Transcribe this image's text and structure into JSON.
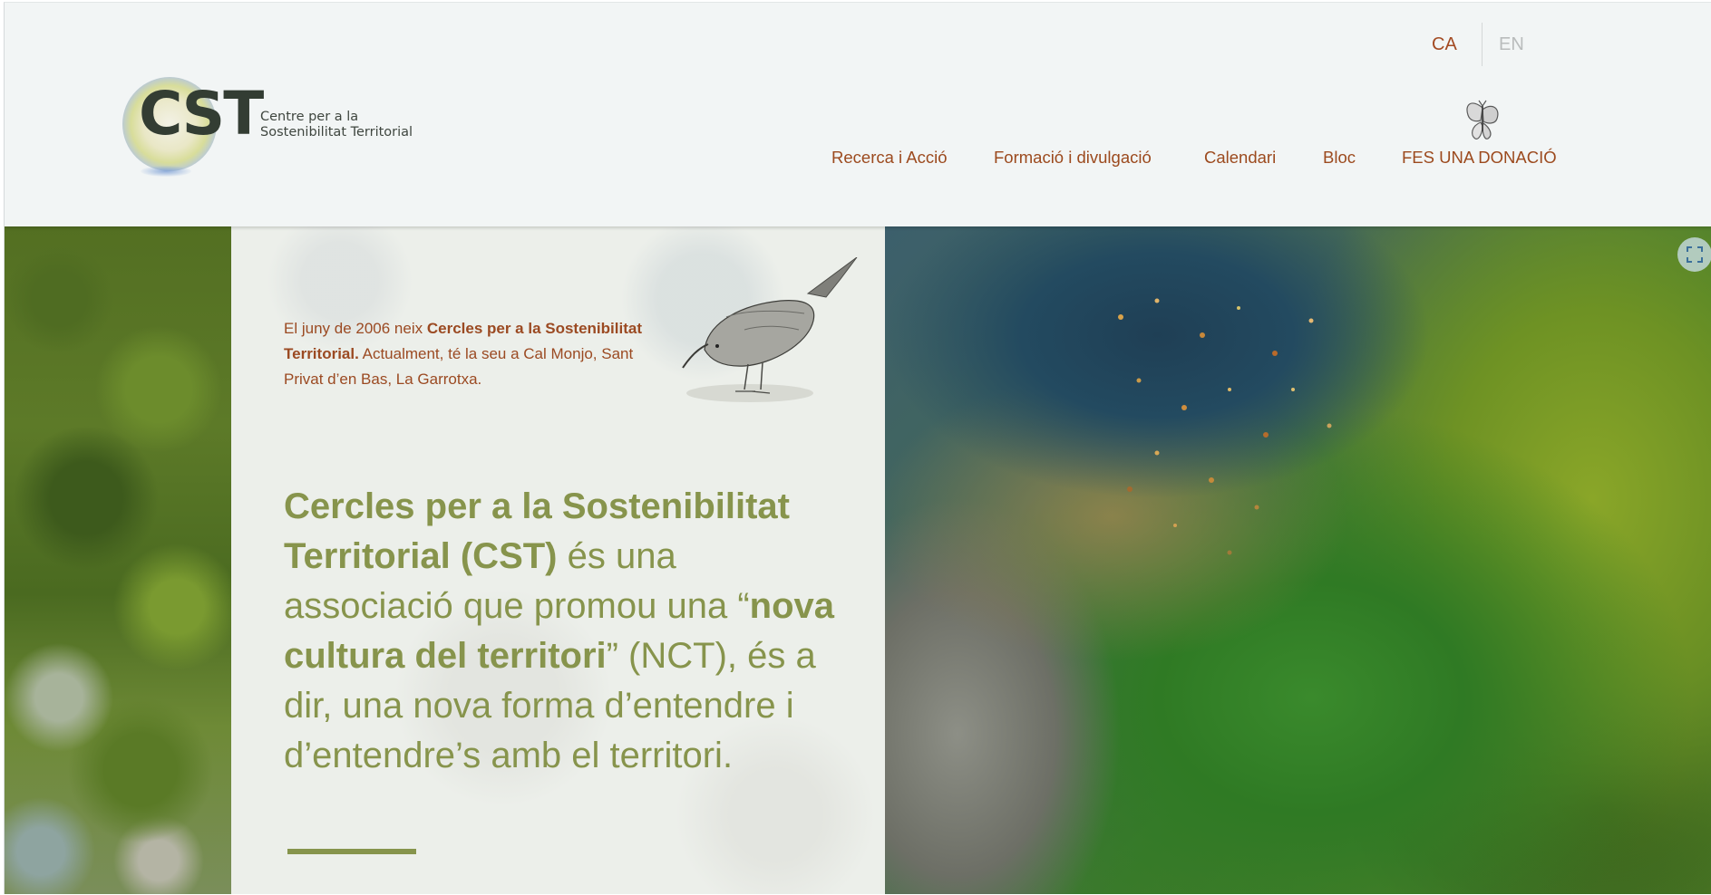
{
  "header": {
    "logo": {
      "mark": "CST",
      "subtitle_line1": "Centre per a la",
      "subtitle_line2": "Sostenibilitat Territorial"
    },
    "languages": [
      {
        "label": "CA",
        "active": true
      },
      {
        "label": "EN",
        "active": false
      }
    ],
    "nav": [
      {
        "label": "Recerca i Acció"
      },
      {
        "label": "Formació i divulgació"
      },
      {
        "label": "Calendari"
      },
      {
        "label": "Bloc"
      },
      {
        "label": "FES UNA DONACIÓ"
      }
    ],
    "nav_icon": "butterfly-icon"
  },
  "hero": {
    "intro": {
      "part1": "El juny de 2006 neix ",
      "bold": "Cercles per a la Sostenibilitat Territorial.",
      "part2": " Actualment, té la seu a Cal Monjo, Sant Privat d’en Bas, La Garrotxa."
    },
    "statement": {
      "bold1": "Cercles per a la Sostenibilitat Territorial (CST)",
      "text1": " és una associació que promou una “",
      "bold2": "nova cultura del territori",
      "text2": "” (NCT), és a dir, una nova forma d’entendre i d’entendre’s amb el territori."
    },
    "illustration": "bird-drawing",
    "zoom_icon": "fullscreen-icon"
  },
  "colors": {
    "accent_brown": "#9c4a1e",
    "olive_green": "#87944c",
    "header_bg": "#f2f5f5",
    "lang_inactive": "#b9bcbc"
  }
}
